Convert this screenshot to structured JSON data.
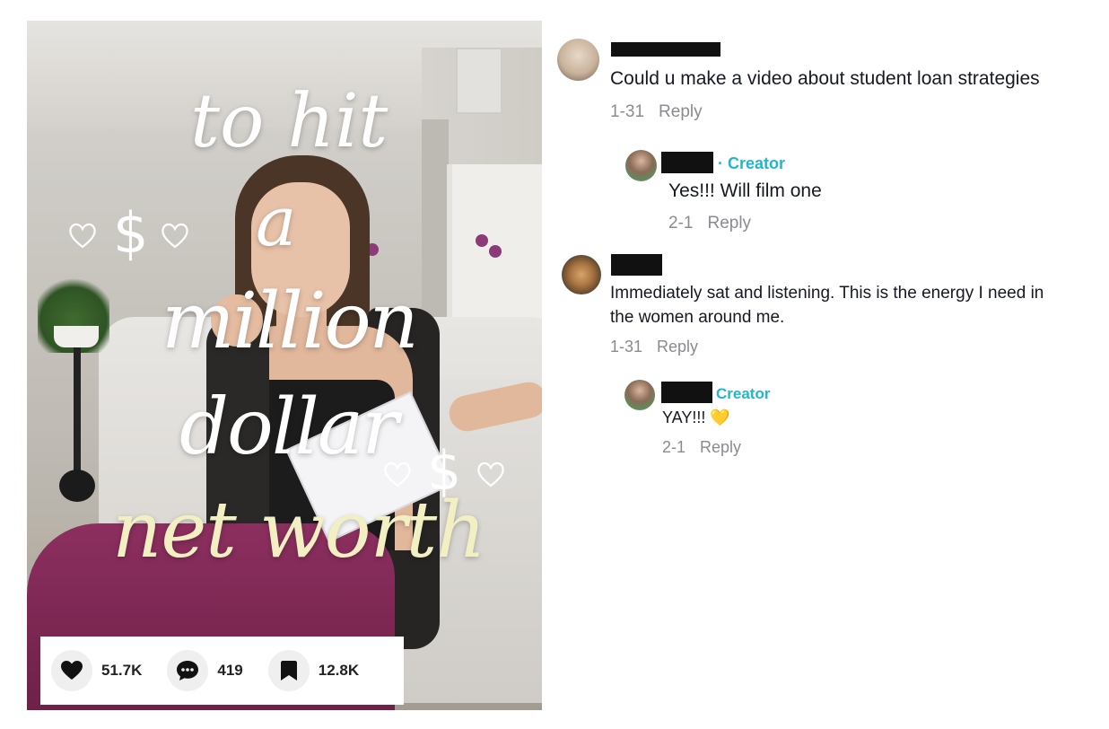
{
  "video": {
    "overlay_lines": [
      "to hit",
      "a",
      "million",
      "dollar",
      "net worth"
    ],
    "doodle_dollar": "$",
    "stats": {
      "likes": "51.7K",
      "comments": "419",
      "saves": "12.8K"
    },
    "icons": [
      "heart-icon",
      "comment-icon",
      "bookmark-icon"
    ]
  },
  "comments": [
    {
      "text": "Could u make a video about student loan strategies",
      "date": "1-31",
      "reply_label": "Reply",
      "replies": [
        {
          "badge": "· Creator",
          "text": "Yes!!! Will film one",
          "date": "2-1",
          "reply_label": "Reply"
        }
      ]
    },
    {
      "text_line1": "Immediately sat and listening. This is the energy I need in",
      "text_line2": "the women around me.",
      "date": "1-31",
      "reply_label": "Reply",
      "replies": [
        {
          "badge": "Creator",
          "text": "YAY!!!",
          "emoji": "💛",
          "date": "2-1",
          "reply_label": "Reply"
        }
      ]
    }
  ],
  "colors": {
    "creator_badge": "#20b6cf",
    "meta_text": "#8a8b91",
    "comment_text": "#161823"
  }
}
